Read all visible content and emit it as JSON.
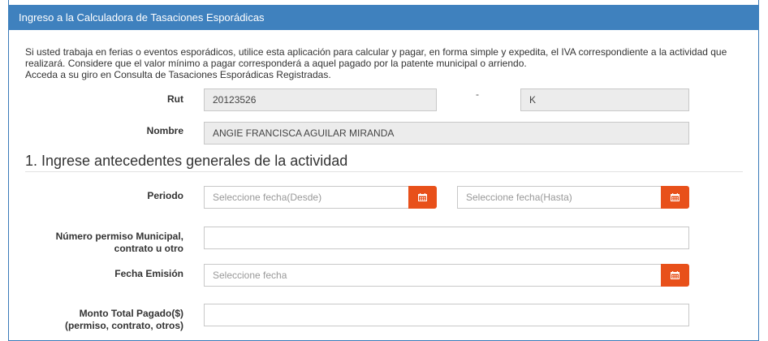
{
  "header": {
    "title": "Ingreso a la Calculadora de Tasaciones Esporádicas"
  },
  "intro": {
    "line1": "Si usted trabaja en ferias o eventos esporádicos, utilice esta aplicación para calcular y pagar, en forma simple y expedita, el IVA correspondiente a la actividad que realizará. Considere que el valor mínimo a pagar corresponderá a aquel pagado por la patente municipal o arriendo.",
    "line2": "Acceda a su giro en Consulta de Tasaciones Esporádicas Registradas."
  },
  "identity": {
    "rut_label": "Rut",
    "rut_value": "20123526",
    "dash": "-",
    "dv_value": "K",
    "nombre_label": "Nombre",
    "nombre_value": "ANGIE FRANCISCA AGUILAR MIRANDA"
  },
  "section1": {
    "title": "1. Ingrese antecedentes generales de la actividad",
    "periodo_label": "Periodo",
    "desde_placeholder": "Seleccione fecha(Desde)",
    "hasta_placeholder": "Seleccione fecha(Hasta)",
    "permiso_label_line1": "Número permiso Municipal,",
    "permiso_label_line2": "contrato u otro",
    "permiso_value": "",
    "fecha_emision_label": "Fecha Emisión",
    "fecha_emision_placeholder": "Seleccione fecha",
    "monto_label_line1": "Monto Total Pagado($)",
    "monto_label_line2": "(permiso, contrato, otros)",
    "monto_value": ""
  },
  "colors": {
    "header": "#3f81be",
    "calendar_button": "#e8501a"
  },
  "icons": {
    "calendar": "calendar-icon"
  }
}
